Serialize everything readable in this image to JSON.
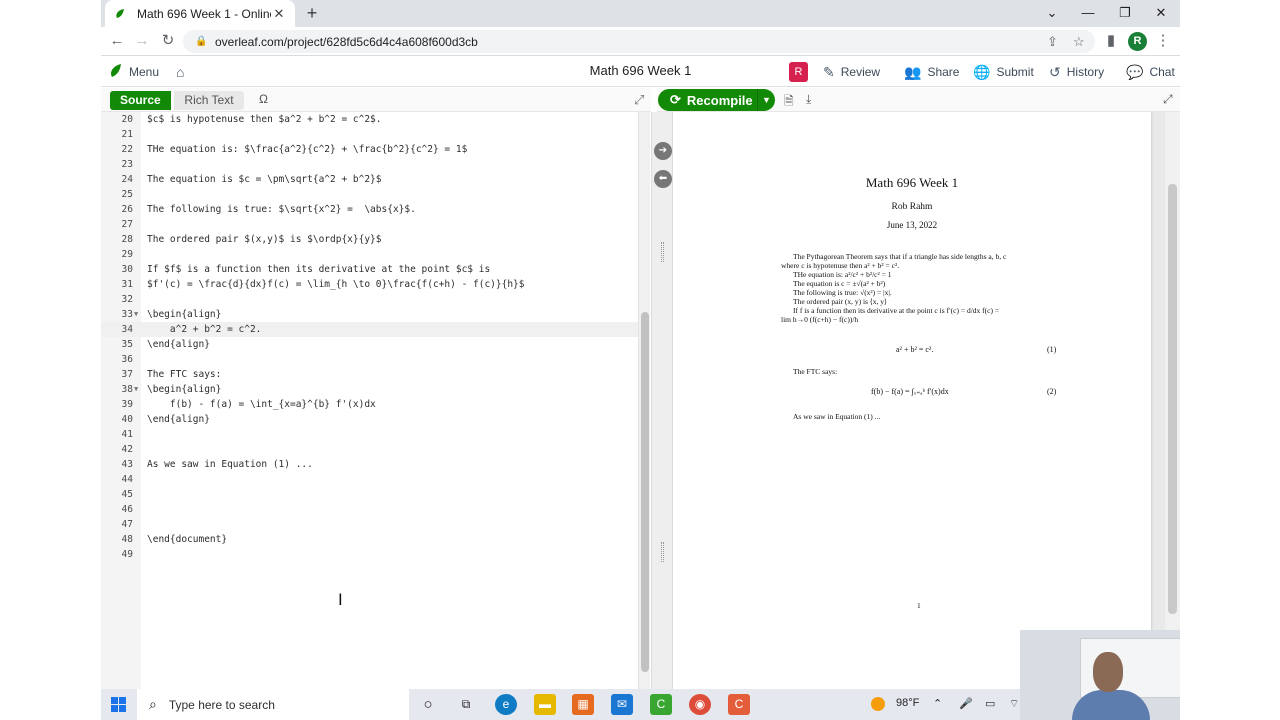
{
  "browser": {
    "tab_title": "Math 696 Week 1 - Online LaTeX",
    "tab_close": "✕",
    "new_tab": "+",
    "url": "overleaf.com/project/628fd5c6d4c4a608f600d3cb",
    "profile_initial": "R",
    "win_min": "—",
    "win_restore": "❐",
    "win_close": "✕",
    "win_down": "⌄"
  },
  "overleaf": {
    "menu_label": "Menu",
    "project_title": "Math 696 Week 1",
    "user_badge": "R",
    "review_label": "Review",
    "share_label": "Share",
    "submit_label": "Submit",
    "history_label": "History",
    "chat_label": "Chat"
  },
  "editor_toolbar": {
    "source_label": "Source",
    "rich_text_label": "Rich Text",
    "omega_label": "Ω"
  },
  "preview_toolbar": {
    "recompile_label": "Recompile"
  },
  "code_lines": [
    {
      "n": "20",
      "text": "$c$ is hypotenuse then $a^2 + b^2 = c^2$."
    },
    {
      "n": "21",
      "text": ""
    },
    {
      "n": "22",
      "text": "THe equation is: $\\frac{a^2}{c^2} + \\frac{b^2}{c^2} = 1$"
    },
    {
      "n": "23",
      "text": ""
    },
    {
      "n": "24",
      "text": "The equation is $c = \\pm\\sqrt{a^2 + b^2}$"
    },
    {
      "n": "25",
      "text": ""
    },
    {
      "n": "26",
      "text": "The following is true: $\\sqrt{x^2} =  \\abs{x}$."
    },
    {
      "n": "27",
      "text": ""
    },
    {
      "n": "28",
      "text": "The ordered pair $(x,y)$ is $\\ordp{x}{y}$"
    },
    {
      "n": "29",
      "text": ""
    },
    {
      "n": "30",
      "text": "If $f$ is a function then its derivative at the point $c$ is"
    },
    {
      "n": "31",
      "text": "$f'(c) = \\frac{d}{dx}f(c) = \\lim_{h \\to 0}\\frac{f(c+h) - f(c)}{h}$"
    },
    {
      "n": "32",
      "text": ""
    },
    {
      "n": "33",
      "text": "\\begin{align}"
    },
    {
      "n": "34",
      "text": "    a^2 + b^2 = c^2."
    },
    {
      "n": "35",
      "text": "\\end{align}"
    },
    {
      "n": "36",
      "text": ""
    },
    {
      "n": "37",
      "text": "The FTC says:"
    },
    {
      "n": "38",
      "text": "\\begin{align}"
    },
    {
      "n": "39",
      "text": "    f(b) - f(a) = \\int_{x=a}^{b} f'(x)dx"
    },
    {
      "n": "40",
      "text": "\\end{align}"
    },
    {
      "n": "41",
      "text": ""
    },
    {
      "n": "42",
      "text": ""
    },
    {
      "n": "43",
      "text": "As we saw in Equation (1) ..."
    },
    {
      "n": "44",
      "text": ""
    },
    {
      "n": "45",
      "text": ""
    },
    {
      "n": "46",
      "text": ""
    },
    {
      "n": "47",
      "text": ""
    },
    {
      "n": "48",
      "text": "\\end{document}"
    },
    {
      "n": "49",
      "text": ""
    }
  ],
  "pdf": {
    "title": "Math 696 Week 1",
    "author": "Rob Rahm",
    "date": "June 13, 2022",
    "para1_line1": "The Pythagorean Theorem says that if a triangle has side lengths a, b, c",
    "para1_line2": "where c is hypotenuse then a² + b² = c².",
    "line_the1": "THe equation is:",
    "line_the1_math": "a²/c² + b²/c² = 1",
    "line_the2": "The equation is c = ±√(a² + b²)",
    "line_the3": "The following is true: √(x²) = |x|.",
    "line_the4": "The ordered pair (x, y) is ⟨x, y⟩",
    "line_deriv1": "If f is a function then its derivative at the point c is f′(c) = d/dx f(c) =",
    "line_deriv2": "lim h→0 (f(c+h) − f(c))/h",
    "eq1": "a² + b² = c².",
    "eq1_num": "(1)",
    "ftc": "The FTC says:",
    "eq2": "f(b) − f(a) = ∫ₓ₌ₐᵇ f′(x)dx",
    "eq2_num": "(2)",
    "as_we_saw": "As we saw in Equation (1) ...",
    "page_number": "1"
  },
  "taskbar": {
    "search_placeholder": "Type here to search",
    "weather": "98°F"
  }
}
